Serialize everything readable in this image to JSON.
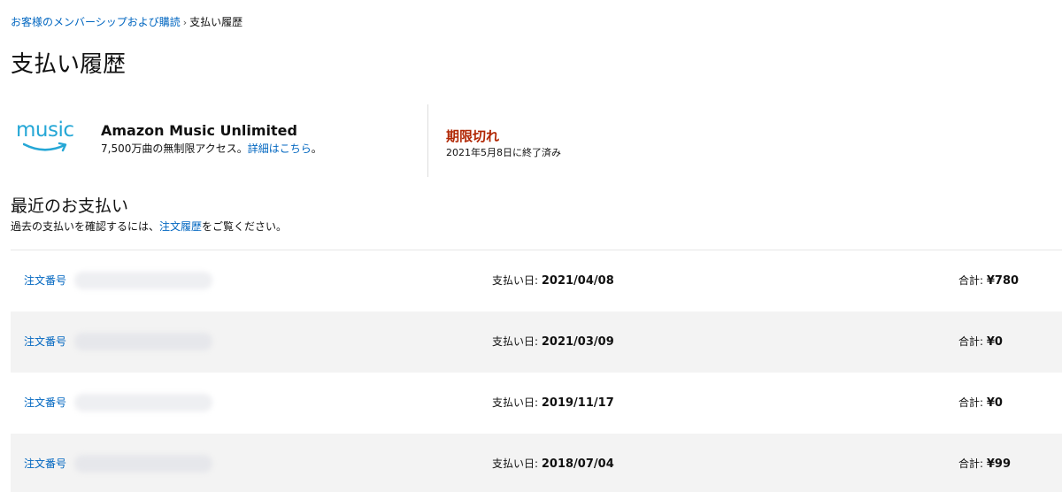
{
  "breadcrumb": {
    "parent": "お客様のメンバーシップおよび購読",
    "separator": "›",
    "current": "支払い履歴"
  },
  "page_title": "支払い履歴",
  "subscription": {
    "logo_text": "music",
    "name": "Amazon Music Unlimited",
    "description_prefix": "7,500万曲の無制限アクセス。",
    "details_link": "詳細はこちら",
    "description_suffix": "。",
    "status": "期限切れ",
    "status_date": "2021年5月8日に終了済み"
  },
  "recent": {
    "title": "最近のお支払い",
    "note_prefix": "過去の支払いを確認するには、",
    "note_link": "注文履歴",
    "note_suffix": "をご覧ください。"
  },
  "payments": [
    {
      "order_label": "注文番号",
      "date_label": "支払い日:",
      "date": "2021/04/08",
      "total_label": "合計:",
      "total": "¥780"
    },
    {
      "order_label": "注文番号",
      "date_label": "支払い日:",
      "date": "2021/03/09",
      "total_label": "合計:",
      "total": "¥0"
    },
    {
      "order_label": "注文番号",
      "date_label": "支払い日:",
      "date": "2019/11/17",
      "total_label": "合計:",
      "total": "¥0"
    },
    {
      "order_label": "注文番号",
      "date_label": "支払い日:",
      "date": "2018/07/04",
      "total_label": "合計:",
      "total": "¥99"
    }
  ],
  "colors": {
    "link": "#0066c0",
    "status_expired": "#b12704",
    "music_logo": "#25a7d6",
    "row_alt": "#f3f3f3"
  }
}
